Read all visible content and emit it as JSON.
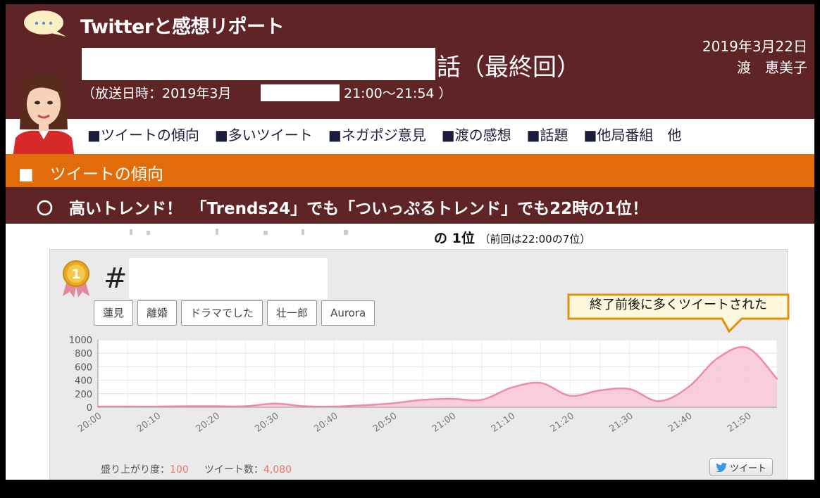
{
  "header": {
    "report_title": "Twitterと感想リポート",
    "episode_suffix": "話（最終回）",
    "air_prefix": "（放送日時：2019年3月",
    "air_time": "21:00～21:54 ）",
    "date": "2019年3月22日",
    "author": "渡　恵美子"
  },
  "nav": {
    "items": [
      "■ツイートの傾向",
      "■多いツイート",
      "■ネガポジ意見",
      "■渡の感想",
      "■話題",
      "■他局番組　他"
    ]
  },
  "section": {
    "title": "■　ツイートの傾向"
  },
  "trend": {
    "headline": "〇　高いトレンド！　「Trends24」でも「ついっぷるトレンド」でも22時の1位！"
  },
  "rank": {
    "text": "の 1位",
    "note": "（前回は22:00の7位）"
  },
  "panel": {
    "medal_number": "1",
    "hash": "#",
    "tags": [
      "蓮見",
      "離婚",
      "ドラマでした",
      "壮一郎",
      "Aurora"
    ],
    "callout": "終了前後に多くツイートされた",
    "stats_label1": "盛り上がり度：",
    "stats_value1": "100",
    "stats_label2": "ツイート数：",
    "stats_value2": "4,080",
    "tweet_button": "ツイート"
  },
  "colors": {
    "header_bg": "#5e2426",
    "section_bg": "#e36c0a",
    "chart_fill": "#f7c6d3",
    "chart_line": "#f08aa8"
  },
  "chart_data": {
    "type": "area",
    "x": [
      "20:00",
      "20:05",
      "20:10",
      "20:15",
      "20:20",
      "20:25",
      "20:30",
      "20:35",
      "20:40",
      "20:45",
      "20:50",
      "20:55",
      "21:00",
      "21:05",
      "21:10",
      "21:15",
      "21:20",
      "21:25",
      "21:30",
      "21:35",
      "21:40",
      "21:45",
      "21:50",
      "21:55"
    ],
    "x_ticks": [
      "20:00",
      "20:10",
      "20:20",
      "20:30",
      "20:40",
      "20:50",
      "21:00",
      "21:10",
      "21:20",
      "21:30",
      "21:40",
      "21:50"
    ],
    "values": [
      10,
      10,
      10,
      15,
      15,
      15,
      55,
      15,
      10,
      30,
      60,
      110,
      125,
      110,
      290,
      360,
      170,
      250,
      270,
      90,
      300,
      730,
      880,
      420
    ],
    "y_ticks": [
      0,
      200,
      400,
      600,
      800,
      1000
    ],
    "ylim": [
      0,
      1000
    ],
    "grid": true
  }
}
